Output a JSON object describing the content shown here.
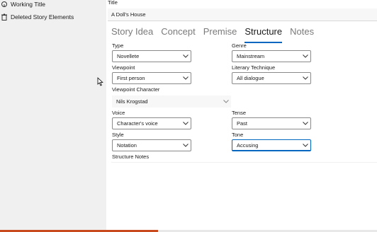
{
  "sidebar": {
    "items": [
      {
        "label": "Working Title",
        "icon": "story-icon"
      },
      {
        "label": "Deleted Story Elements",
        "icon": "trash-icon"
      }
    ]
  },
  "title": {
    "label": "Title",
    "value": "A Doll's House"
  },
  "tabs": [
    "Story Idea",
    "Concept",
    "Premise",
    "Structure",
    "Notes"
  ],
  "active_tab": "Structure",
  "fields": {
    "type": {
      "label": "Type",
      "value": "Novellete"
    },
    "genre": {
      "label": "Genre",
      "value": "Mainstream"
    },
    "viewpoint": {
      "label": "Viewpoint",
      "value": "First person"
    },
    "literary_technique": {
      "label": "Literary Technique",
      "value": "All dialogue"
    },
    "viewpoint_character": {
      "label": "Viewpoint Character",
      "value": "Nils Krogstad"
    },
    "voice": {
      "label": "Voice",
      "value": "Character's voice"
    },
    "tense": {
      "label": "Tense",
      "value": "Past"
    },
    "style": {
      "label": "Style",
      "value": "Notation"
    },
    "tone": {
      "label": "Tone",
      "value": "Accusing"
    }
  },
  "structure_notes": {
    "label": "Structure Notes",
    "value": ""
  },
  "colors": {
    "accent": "#0067c0",
    "sidebar_bg": "#f0f0f0",
    "progress": "#c94a1c"
  },
  "taskbar_progress": 0.42
}
